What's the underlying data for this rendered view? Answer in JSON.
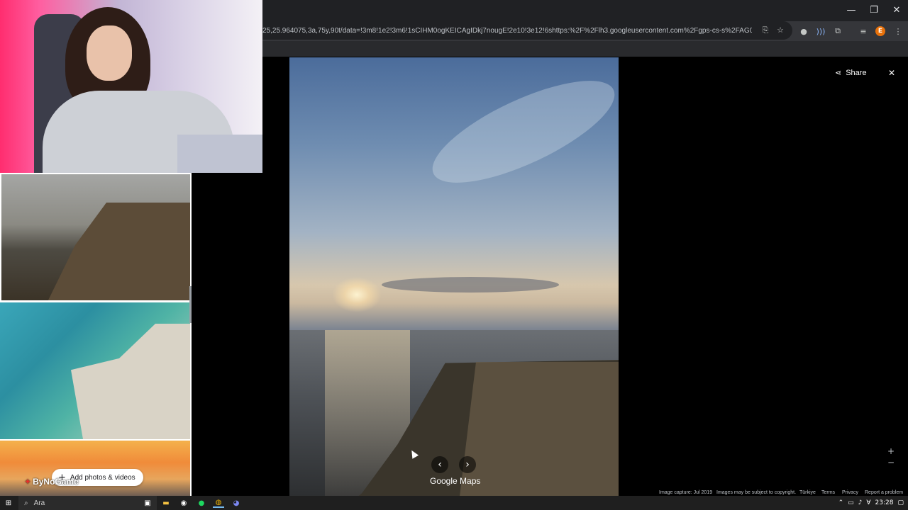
{
  "browser": {
    "url": "25,25.964075,3a,75y,90t/data=!3m8!1e2!3m6!1sCIHM0ogKEICAgIDkj7nougE!2e10!3e12!6shttps:%2F%2Flh3.googleusercontent.com%2Fgps-cs-s%2FAG0ilSxLxlqzcT9TL...",
    "window_controls": {
      "minimize": "—",
      "restore": "❐",
      "close": "✕"
    },
    "profile_initial": "E"
  },
  "viewer": {
    "share_label": "Share",
    "close_icon": "✕",
    "prev_icon": "‹",
    "next_icon": "›",
    "brand": "Google Maps",
    "footer": {
      "capture": "Image capture: Jul 2019",
      "copyright": "Images may be subject to copyright.",
      "country": "Türkiye",
      "terms": "Terms",
      "privacy": "Privacy",
      "report": "Report a problem"
    },
    "zoom_in": "+",
    "zoom_out": "−"
  },
  "gallery": {
    "add_photos_label": "Add photos & videos"
  },
  "overlay": {
    "watermark": "ByNoGame"
  },
  "taskbar": {
    "search_placeholder": "Ara",
    "clock": "23:28"
  }
}
